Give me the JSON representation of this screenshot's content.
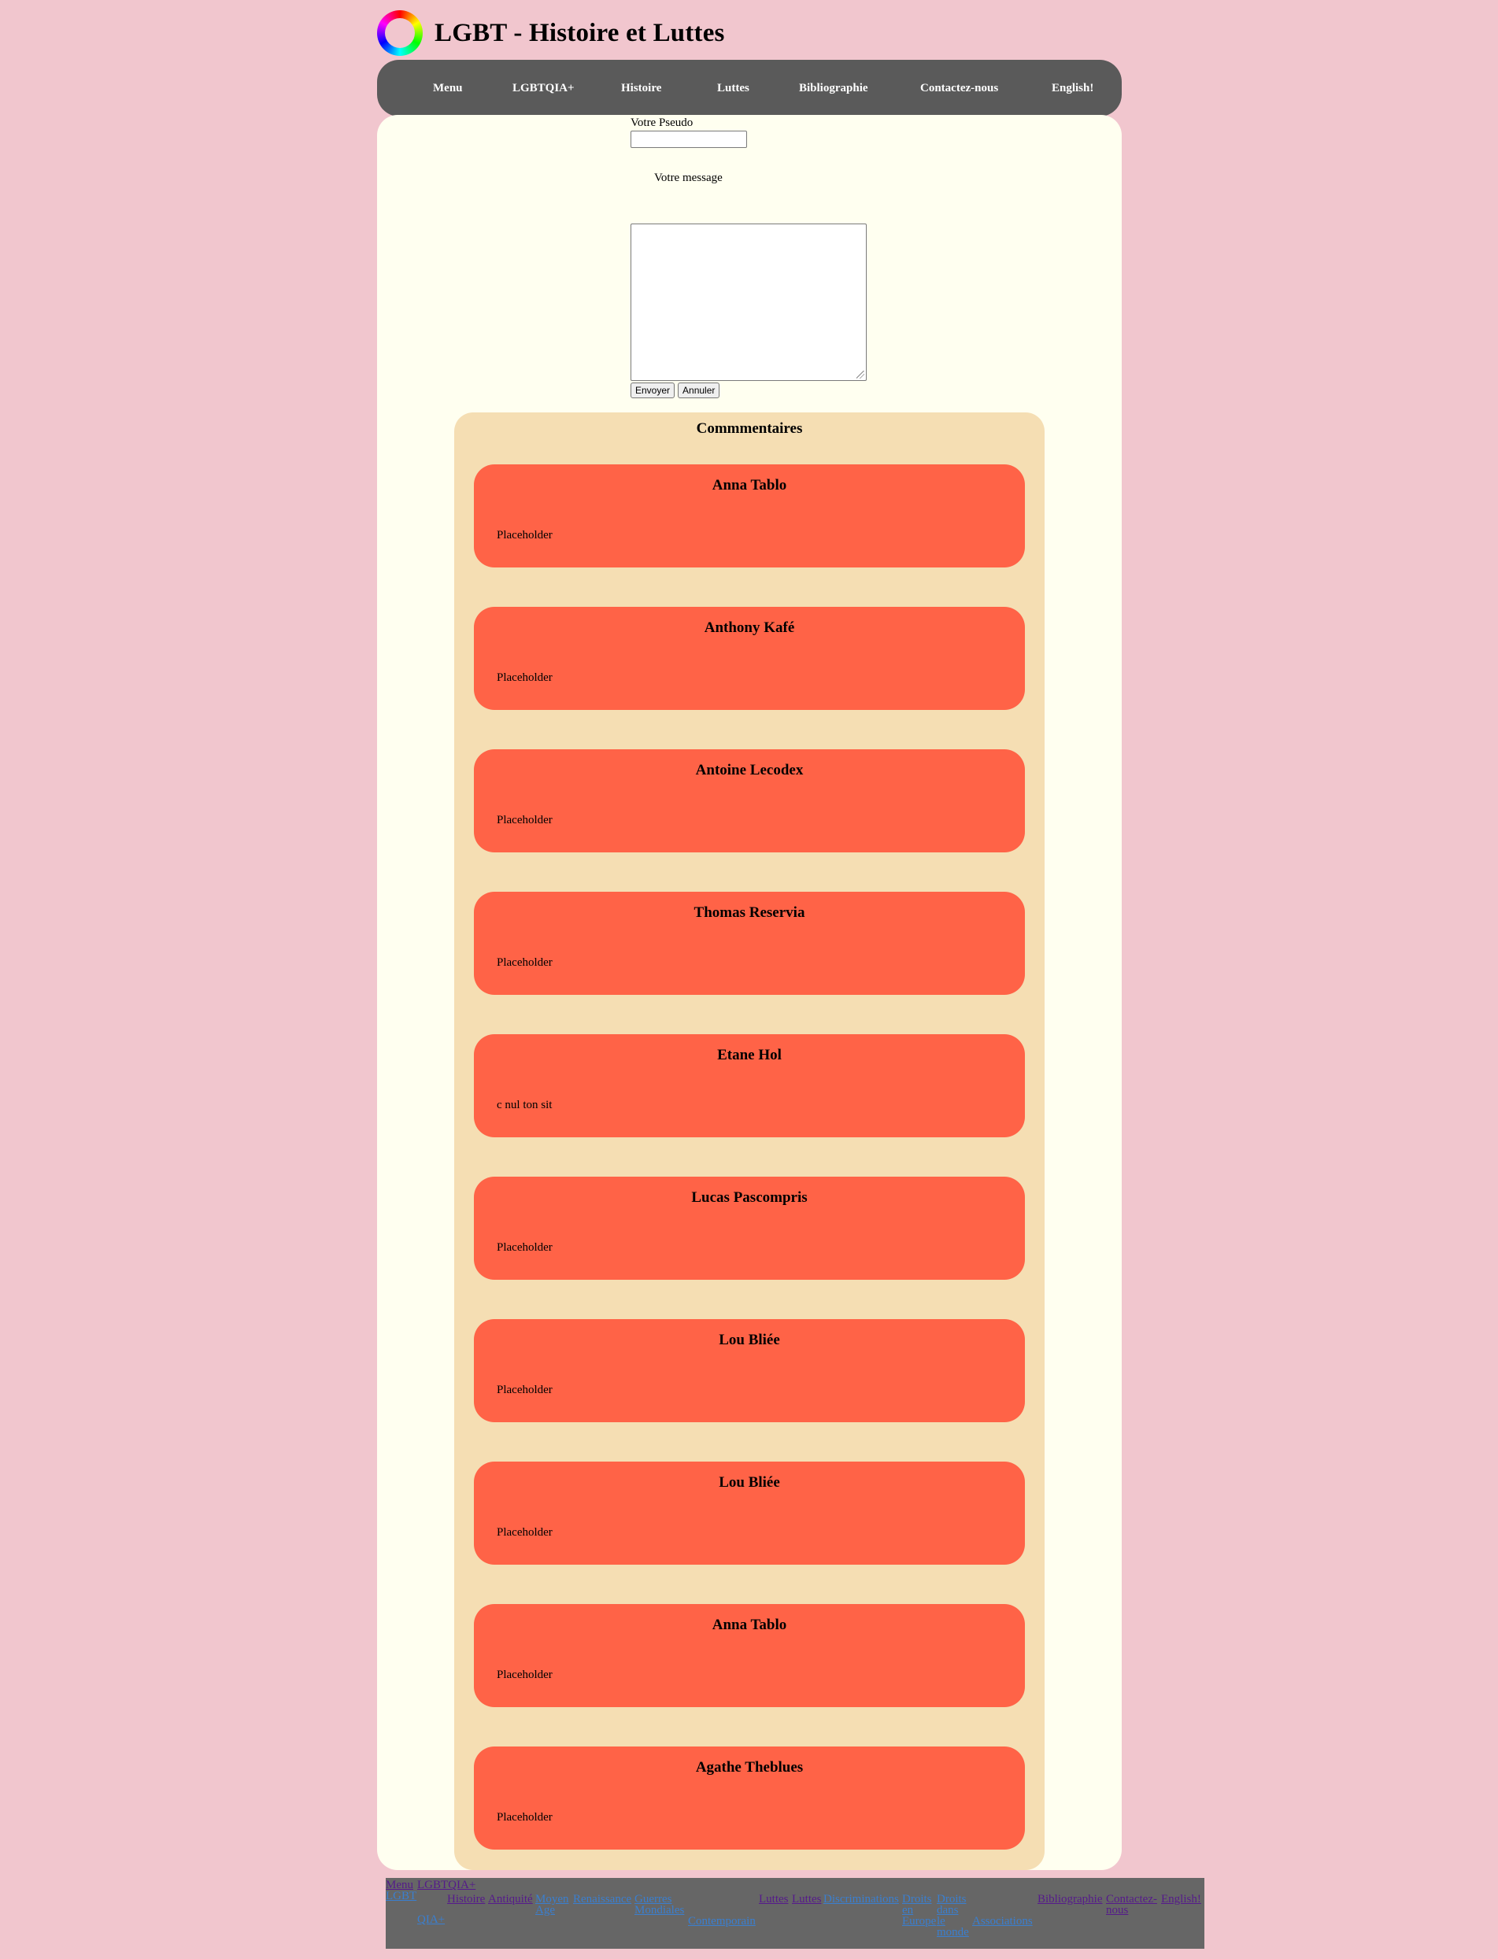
{
  "site": {
    "title": "LGBT - Histoire et Luttes",
    "logo_icon": "rainbow-ring-icon"
  },
  "nav": [
    "Menu",
    "LGBTQIA+",
    "Histoire",
    "Luttes",
    "Bibliographie",
    "Contactez-nous",
    "English!"
  ],
  "form": {
    "pseudo_label": "Votre Pseudo",
    "pseudo_value": "",
    "message_label": "Votre message",
    "message_value": "",
    "submit_label": "Envoyer",
    "cancel_label": "Annuler"
  },
  "comments": {
    "title": "Commmentaires",
    "items": [
      {
        "name": "Anna Tablo",
        "text": "Placeholder"
      },
      {
        "name": "Anthony Kafé",
        "text": "Placeholder"
      },
      {
        "name": "Antoine Lecodex",
        "text": "Placeholder"
      },
      {
        "name": "Thomas Reservia",
        "text": "Placeholder"
      },
      {
        "name": "Etane Hol",
        "text": "c nul ton sit"
      },
      {
        "name": "Lucas Pascompris",
        "text": "Placeholder"
      },
      {
        "name": "Lou Bliée",
        "text": "Placeholder"
      },
      {
        "name": "Lou Bliée",
        "text": "Placeholder"
      },
      {
        "name": "Anna Tablo",
        "text": "Placeholder"
      },
      {
        "name": "Agathe Theblues",
        "text": "Placeholder"
      }
    ]
  },
  "footer": {
    "links": [
      "Menu",
      "LGBT",
      "LGBTQIA+",
      "QIA+",
      "Histoire",
      "Antiquité",
      "Moyen Age",
      "Renaissance",
      "Guerres Mondiales",
      "Contemporain",
      "Luttes",
      "Luttes",
      "Discriminations",
      "Droits en Europe",
      "Droits dans le monde",
      "Associations",
      "Bibliographie",
      "Contactez-nous",
      "English!"
    ]
  },
  "colors": {
    "background": "#f1c6ce",
    "nav": "#5a5a5a",
    "panel": "#fffff0",
    "comments_bg": "#f5deb3",
    "card": "#ff6347",
    "footer": "#666666"
  }
}
